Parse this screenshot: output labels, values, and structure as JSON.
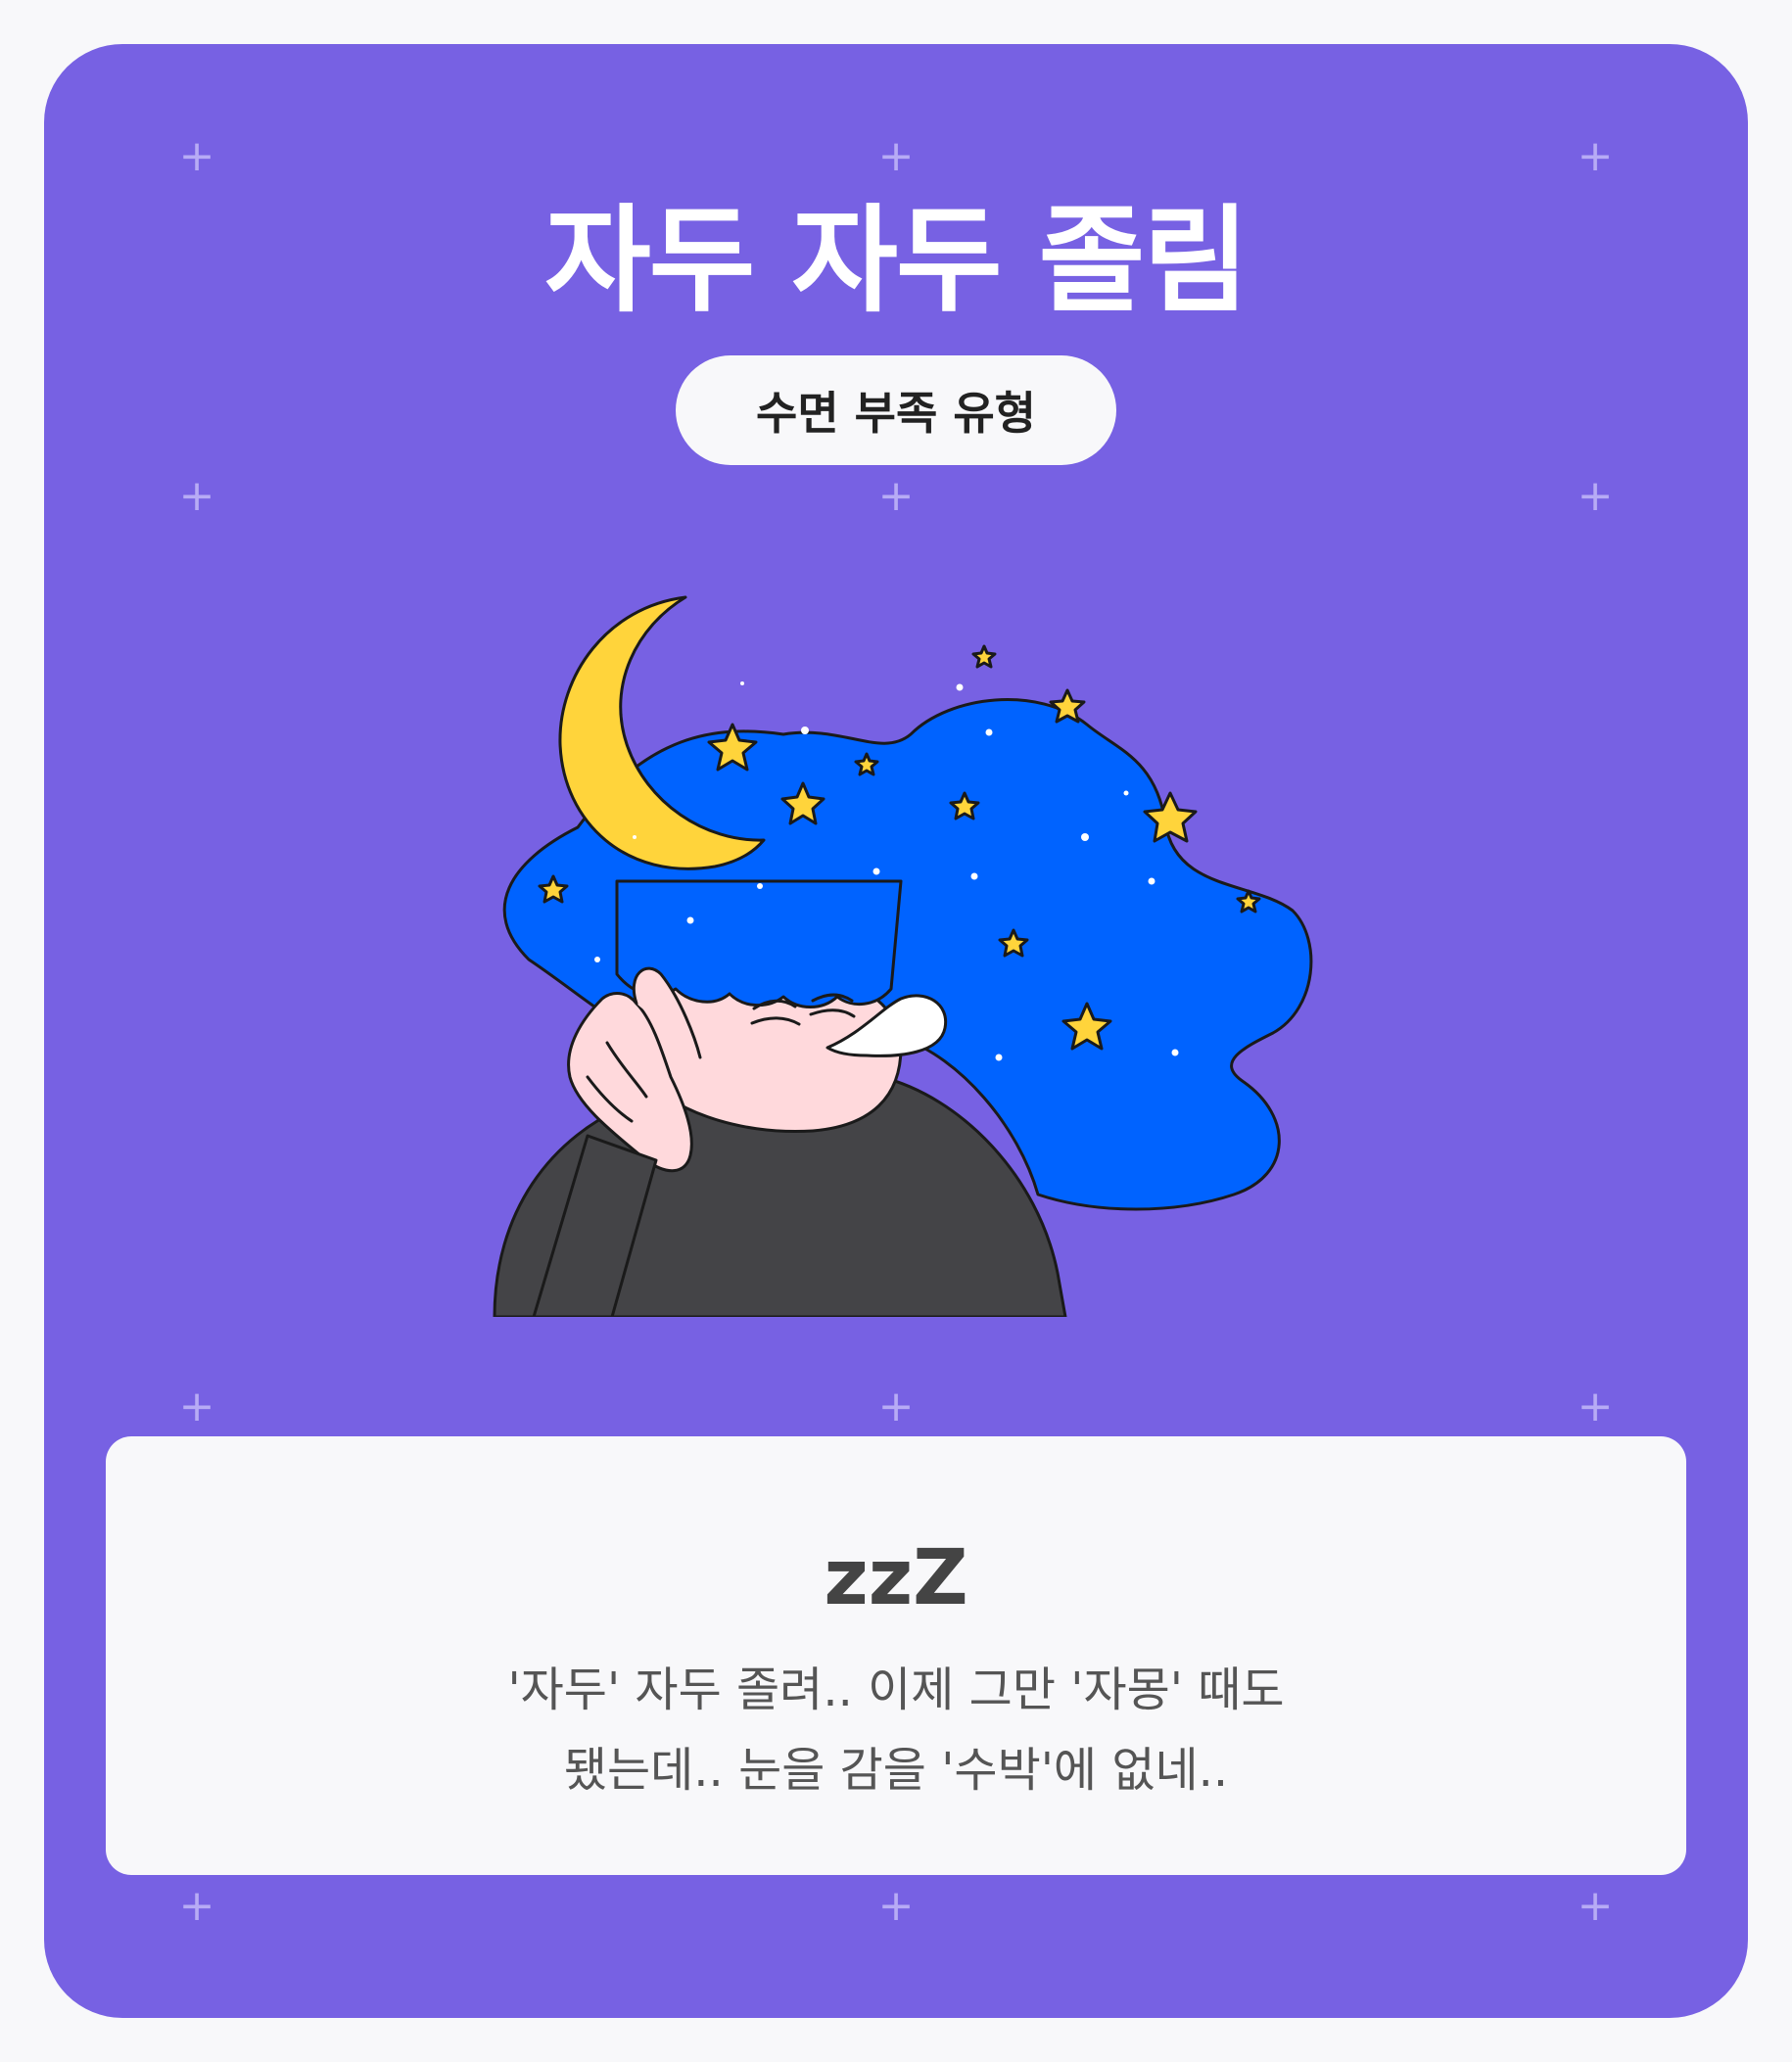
{
  "title": "자두 자두 졸림",
  "type_badge": "수면 부족 유형",
  "result": {
    "heading": "zzZ",
    "description_lines": [
      "'자두' 자두 졸려.. 이제 그만 '자몽' 때도",
      "됐는데.. 눈을 감을 '수박'에 없네.."
    ]
  },
  "decorations": {
    "plus_glyph": "+"
  },
  "illustration": {
    "name": "sleepy-person-with-night-sky-hair",
    "icon": "sleepy-person-illustration"
  },
  "colors": {
    "card_background": "#7761e3",
    "page_background": "#f8f8fa",
    "hair_blue": "#0063ff",
    "moon_yellow": "#ffd43b",
    "sweater": "#444447",
    "skin": "#ffd9dc"
  }
}
